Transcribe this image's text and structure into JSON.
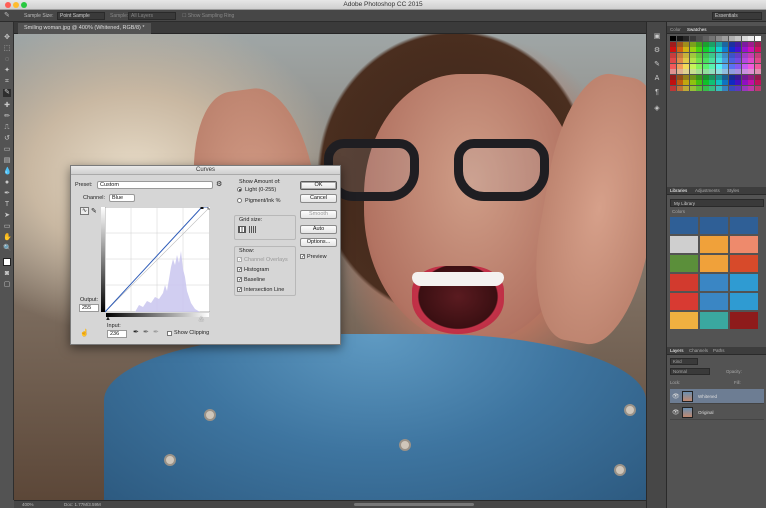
{
  "window": {
    "title": "Adobe Photoshop CC 2015"
  },
  "options_bar": {
    "sample_size_label": "Sample Size:",
    "sample_size_value": "Point Sample",
    "sample_label": "Sample:",
    "sample_value": "All Layers",
    "show_ring_label": "Show Sampling Ring",
    "workspace": "Essentials"
  },
  "document": {
    "tab": "Smiling woman.jpg @ 400% (Whitened, RGB/8) *"
  },
  "status_bar": {
    "zoom": "400%",
    "doc": "Doc: 1.77M/3.59M"
  },
  "panels": {
    "color_tabs": [
      "Color",
      "Swatches"
    ],
    "library_tabs": [
      "Libraries",
      "Adjustments",
      "Styles"
    ],
    "library_select": "My Library",
    "colors_label": "Colors",
    "layers_tabs": [
      "Layers",
      "Channels",
      "Paths"
    ],
    "kind_label": "Kind",
    "blend_mode": "Normal",
    "opacity_label": "Opacity:",
    "fill_label": "Fill:",
    "lock_label": "Lock:",
    "layers": [
      {
        "name": "Whitened",
        "selected": true
      },
      {
        "name": "Original",
        "selected": false
      }
    ]
  },
  "library_colors": [
    "#2f5f96",
    "#2f5f96",
    "#2f5f96",
    "#cfcfcf",
    "#f0a13a",
    "#ee8a6c",
    "#5b8f3a",
    "#f0a13a",
    "#d74a2a",
    "#d23a2e",
    "#3a86c4",
    "#2f9bd2",
    "#d83a32",
    "#3a86c4",
    "#2f9bd2",
    "#f0b040",
    "#3aa8a0",
    "#8e1b1b"
  ],
  "curves": {
    "title": "Curves",
    "preset_label": "Preset:",
    "preset_value": "Custom",
    "channel_label": "Channel:",
    "channel_value": "Blue",
    "output_label": "Output:",
    "output_value": "255",
    "input_label": "Input:",
    "input_value": "236",
    "show_clipping": "Show Clipping",
    "show_amount_label": "Show Amount of:",
    "light_option": "Light  (0-255)",
    "pigment_option": "Pigment/Ink %",
    "grid_size_label": "Grid size:",
    "show_label": "Show:",
    "show_options": [
      "Channel Overlays",
      "Histogram",
      "Baseline",
      "Intersection Line"
    ],
    "buttons": {
      "ok": "OK",
      "cancel": "Cancel",
      "smooth": "Smooth",
      "auto": "Auto",
      "options": "Options..."
    },
    "preview": "Preview"
  }
}
